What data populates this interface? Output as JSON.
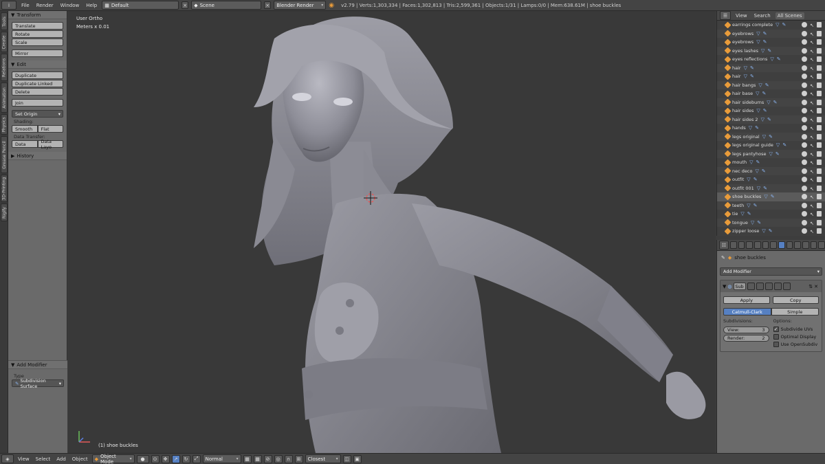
{
  "topbar": {
    "menus": [
      "File",
      "Render",
      "Window",
      "Help"
    ],
    "layout": "Default",
    "scene": "Scene",
    "engine": "Blender Render",
    "stats": "v2.79 | Verts:1,303,334 | Faces:1,302,813 | Tris:2,599,361 | Objects:1/31 | Lamps:0/0 | Mem:638.61M | shoe buckles"
  },
  "vtabs": [
    "Tools",
    "Create",
    "Relations",
    "Animation",
    "Physics",
    "Grease Pencil",
    "3D-Printing",
    "Rigify"
  ],
  "toolshelf": {
    "transform": {
      "header": "Transform",
      "buttons": [
        "Translate",
        "Rotate",
        "Scale",
        "Mirror"
      ]
    },
    "edit": {
      "header": "Edit",
      "buttons": [
        "Duplicate",
        "Duplicate Linked",
        "Delete",
        "Join"
      ],
      "set_origin": "Set Origin",
      "shading_label": "Shading:",
      "smooth": "Smooth",
      "flat": "Flat",
      "data_transfer_label": "Data Transfer:",
      "data": "Data",
      "data_layout": "Data Layo"
    },
    "history": "History",
    "last_op": {
      "header": "Add Modifier",
      "type_label": "Type",
      "type_value": "Subdivision Surface"
    }
  },
  "viewport": {
    "view_name": "User Ortho",
    "scale": "Meters x 0.01",
    "active_object": "(1) shoe buckles"
  },
  "bottombar": {
    "menus": [
      "View",
      "Select",
      "Add",
      "Object"
    ],
    "mode": "Object Mode",
    "pivot": "Normal",
    "snap": "Closest"
  },
  "outliner": {
    "tabs": [
      "View",
      "Search",
      "All Scenes"
    ],
    "items": [
      {
        "name": "earrings complete",
        "selected": false
      },
      {
        "name": "eyebrows",
        "selected": false
      },
      {
        "name": "eyebrows",
        "selected": false
      },
      {
        "name": "eyes lashes",
        "selected": false
      },
      {
        "name": "eyes reflections",
        "selected": false
      },
      {
        "name": "hair",
        "selected": false
      },
      {
        "name": "hair",
        "selected": false
      },
      {
        "name": "hair bangs",
        "selected": false
      },
      {
        "name": "hair base",
        "selected": false
      },
      {
        "name": "hair sideburns",
        "selected": false
      },
      {
        "name": "hair sides",
        "selected": false
      },
      {
        "name": "hair sides 2",
        "selected": false
      },
      {
        "name": "hands",
        "selected": false
      },
      {
        "name": "legs original",
        "selected": false
      },
      {
        "name": "legs original guide",
        "selected": false
      },
      {
        "name": "legs pantyhose",
        "selected": false
      },
      {
        "name": "mouth",
        "selected": false
      },
      {
        "name": "nec deco",
        "selected": false
      },
      {
        "name": "outfit",
        "selected": false
      },
      {
        "name": "outfit 001",
        "selected": false
      },
      {
        "name": "shoe buckles",
        "selected": true
      },
      {
        "name": "teeth",
        "selected": false
      },
      {
        "name": "tie",
        "selected": false
      },
      {
        "name": "tongue",
        "selected": false
      },
      {
        "name": "zipper loose",
        "selected": false
      }
    ]
  },
  "properties": {
    "object_name": "shoe buckles",
    "add_modifier": "Add Modifier",
    "modifier_short": "Sub",
    "apply": "Apply",
    "copy": "Copy",
    "algo_catmull": "Catmull-Clark",
    "algo_simple": "Simple",
    "subdivisions_label": "Subdivisions:",
    "options_label": "Options:",
    "view_label": "View:",
    "view_value": "3",
    "render_label": "Render:",
    "render_value": "2",
    "subdivide_uvs": "Subdivide UVs",
    "optimal_display": "Optimal Display",
    "use_opensubdiv": "Use OpenSubdiv"
  }
}
